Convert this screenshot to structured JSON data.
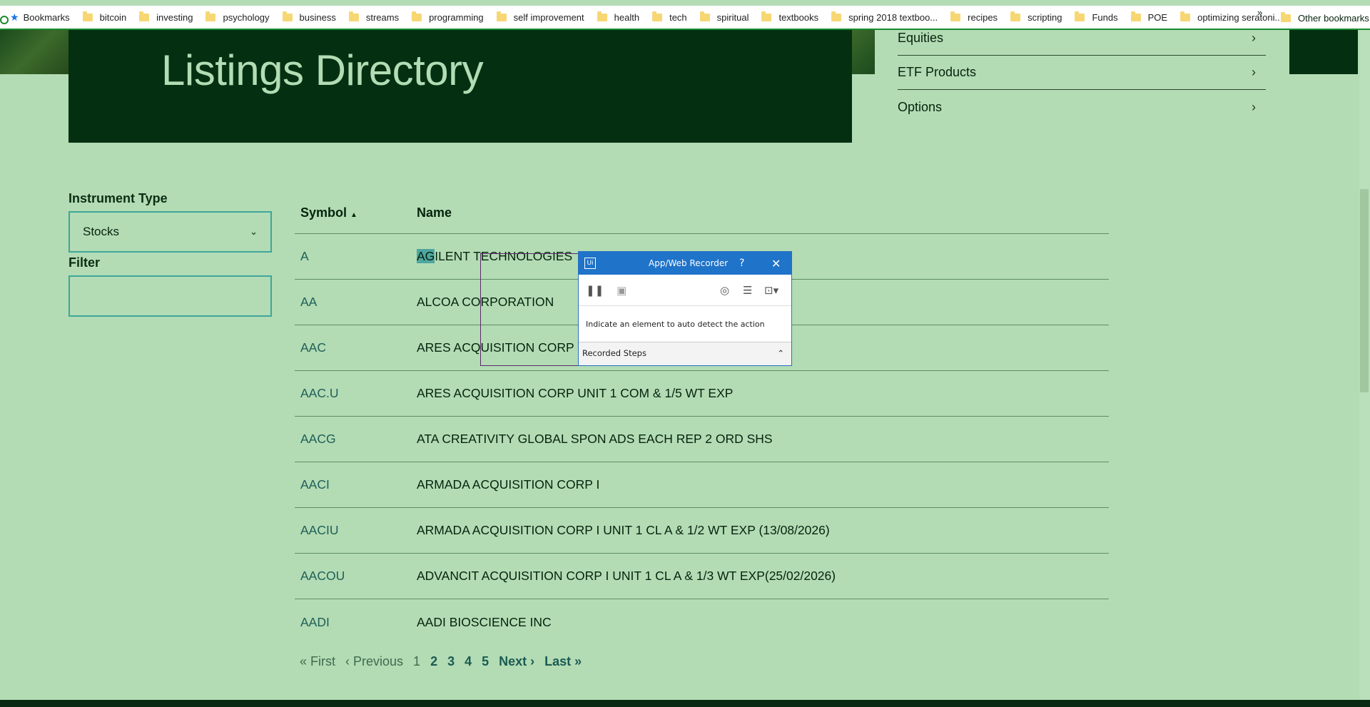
{
  "bookmarks": {
    "items": [
      "Bookmarks",
      "bitcoin",
      "investing",
      "psychology",
      "business",
      "streams",
      "programming",
      "self improvement",
      "health",
      "tech",
      "spiritual",
      "textbooks",
      "spring 2018 textboo...",
      "recipes",
      "scripting",
      "Funds",
      "POE",
      "optimizing seratoni..."
    ],
    "more": "»",
    "other": "Other bookmarks"
  },
  "hero": {
    "title": "Listings Directory"
  },
  "side_links": [
    "Equities",
    "ETF Products",
    "Options"
  ],
  "filters": {
    "instrument_label": "Instrument Type",
    "instrument_value": "Stocks",
    "filter_label": "Filter",
    "filter_value": ""
  },
  "table": {
    "col_symbol": "Symbol",
    "col_name": "Name",
    "rows": [
      {
        "symbol": "A",
        "name_hl": "AG",
        "name": "ILENT TECHNOLOGIES"
      },
      {
        "symbol": "AA",
        "name_hl": "",
        "name": "ALCOA CORPORATION"
      },
      {
        "symbol": "AAC",
        "name_hl": "",
        "name": "ARES ACQUISITION CORP"
      },
      {
        "symbol": "AAC.U",
        "name_hl": "",
        "name": "ARES ACQUISITION CORP UNIT 1 COM & 1/5 WT EXP"
      },
      {
        "symbol": "AACG",
        "name_hl": "",
        "name": "ATA CREATIVITY GLOBAL SPON ADS EACH REP 2 ORD SHS"
      },
      {
        "symbol": "AACI",
        "name_hl": "",
        "name": "ARMADA ACQUISITION CORP I"
      },
      {
        "symbol": "AACIU",
        "name_hl": "",
        "name": "ARMADA ACQUISITION CORP I UNIT 1 CL A & 1/2 WT EXP (13/08/2026)"
      },
      {
        "symbol": "AACOU",
        "name_hl": "",
        "name": "ADVANCIT ACQUISITION CORP I UNIT 1 CL A & 1/3 WT EXP(25/02/2026)"
      },
      {
        "symbol": "AADI",
        "name_hl": "",
        "name": "AADI BIOSCIENCE INC"
      }
    ]
  },
  "pager": {
    "first": "« First",
    "previous": "‹ Previous",
    "current": "1",
    "pages": [
      "2",
      "3",
      "4",
      "5"
    ],
    "next": "Next ›",
    "last": "Last »"
  },
  "recorder": {
    "logo": "Ui",
    "title": "App/Web Recorder",
    "help": "?",
    "close": "✕",
    "message": "Indicate an element to auto detect the action",
    "steps_label": "Recorded Steps"
  }
}
